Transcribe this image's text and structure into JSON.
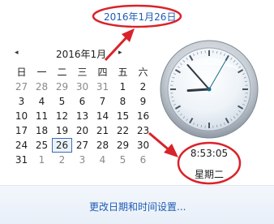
{
  "header": {
    "date_link": "2016年1月26日"
  },
  "calendar": {
    "month_title": "2016年1月",
    "prev_glyph": "◂",
    "next_glyph": "▸",
    "weekdays": [
      "日",
      "一",
      "二",
      "三",
      "四",
      "五",
      "六"
    ],
    "weeks": [
      [
        "27",
        "28",
        "29",
        "30",
        "31",
        "1",
        "2"
      ],
      [
        "3",
        "4",
        "5",
        "6",
        "7",
        "8",
        "9"
      ],
      [
        "10",
        "11",
        "12",
        "13",
        "14",
        "15",
        "16"
      ],
      [
        "17",
        "18",
        "19",
        "20",
        "21",
        "22",
        "23"
      ],
      [
        "24",
        "25",
        "26",
        "27",
        "28",
        "29",
        "30"
      ],
      [
        "31",
        "1",
        "2",
        "3",
        "4",
        "5",
        "6"
      ]
    ],
    "selected_day": "26"
  },
  "clock": {
    "time": "8:53:05",
    "weekday": "星期二"
  },
  "footer": {
    "settings_link": "更改日期和时间设置..."
  },
  "colors": {
    "link": "#1e5bb4",
    "annotation": "#d9232a",
    "selected_border": "#3d6db2"
  }
}
